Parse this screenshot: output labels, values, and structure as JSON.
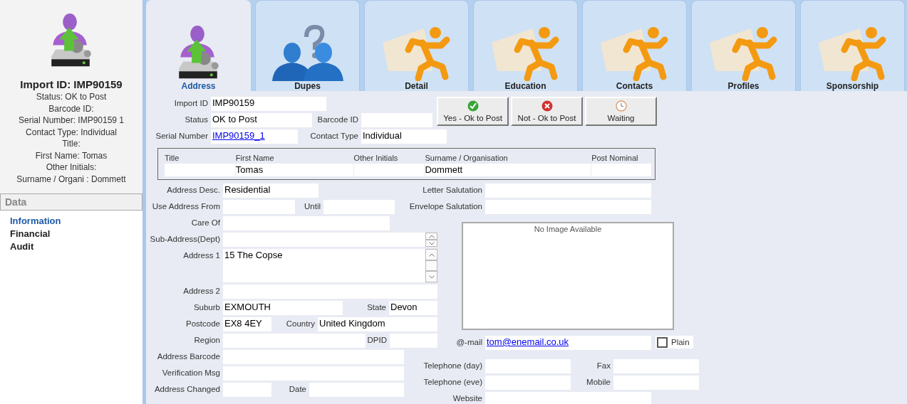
{
  "sidebar": {
    "title": "Import ID: IMP90159",
    "details": [
      "Status: OK to Post",
      "Barcode ID:",
      "Serial Number: IMP90159 1",
      "Contact Type: Individual",
      "Title:",
      "First Name: Tomas",
      "Other Initials:",
      "Surname / Organi : Dommett"
    ],
    "section": "Data",
    "items": [
      {
        "label": "Information",
        "selected": true
      },
      {
        "label": "Financial",
        "selected": false
      },
      {
        "label": "Audit",
        "selected": false
      }
    ]
  },
  "tabs": [
    {
      "label": "Address",
      "selected": true
    },
    {
      "label": "Dupes",
      "selected": false
    },
    {
      "label": "Detail",
      "selected": false
    },
    {
      "label": "Education",
      "selected": false
    },
    {
      "label": "Contacts",
      "selected": false
    },
    {
      "label": "Profiles",
      "selected": false
    },
    {
      "label": "Sponsorship",
      "selected": false
    }
  ],
  "form": {
    "top_rows": [
      {
        "kind": "fields",
        "fields": [
          {
            "label": "Import ID",
            "value": "IMP90159",
            "kind": "text"
          }
        ]
      },
      {
        "kind": "fields",
        "fields": [
          {
            "label": "Status",
            "value": "OK to Post",
            "kind": "text"
          },
          {
            "label": "Barcode ID",
            "kind": "text"
          }
        ]
      },
      {
        "kind": "fields",
        "fields": [
          {
            "label": "Serial Number",
            "value": "IMP90159_1",
            "kind": "link"
          },
          {
            "label": "Contact Type",
            "value": "Individual",
            "kind": "text"
          }
        ]
      }
    ],
    "status_buttons": [
      "Yes - Ok to Post",
      "Not - Ok to Post",
      "Waiting"
    ],
    "name_grid": [
      {
        "heading": "Title"
      },
      {
        "heading": "First Name",
        "value": "Tomas"
      },
      {
        "heading": "Other Initials"
      },
      {
        "heading": "Surname / Organisation",
        "value": "Dommett"
      },
      {
        "heading": "Post Nominal"
      }
    ],
    "address_rows": [
      {
        "kind": "fields",
        "fields": [
          {
            "label": "Address Desc.",
            "value": "Residential",
            "kind": "text"
          }
        ]
      },
      {
        "kind": "fields",
        "fields": [
          {
            "label": "Use Address From",
            "kind": "text"
          },
          {
            "label": "Until",
            "kind": "text"
          }
        ]
      },
      {
        "kind": "fields",
        "fields": [
          {
            "label": "Care Of",
            "kind": "text"
          }
        ]
      },
      {
        "kind": "fields",
        "fields": [
          {
            "label": "Sub-Address(Dept)",
            "kind": "spin"
          }
        ]
      },
      {
        "kind": "fields",
        "fields": [
          {
            "label": "Address 1",
            "value": "15 The Copse",
            "kind": "memo"
          }
        ]
      },
      {
        "kind": "fields",
        "fields": [
          {
            "label": "Address 2",
            "kind": "text"
          }
        ]
      },
      {
        "kind": "fields",
        "fields": [
          {
            "label": "Suburb",
            "value": "EXMOUTH",
            "kind": "text"
          },
          {
            "label": "State",
            "value": "Devon",
            "kind": "text"
          }
        ]
      },
      {
        "kind": "fields",
        "fields": [
          {
            "label": "Postcode",
            "value": "EX8 4EY",
            "kind": "text"
          },
          {
            "label": "Country",
            "value": "United Kingdom",
            "kind": "text"
          }
        ]
      },
      {
        "kind": "fields",
        "fields": [
          {
            "label": "Region",
            "kind": "text"
          },
          {
            "label": "DPID",
            "kind": "text"
          }
        ]
      },
      {
        "kind": "fields",
        "fields": [
          {
            "label": "Address Barcode",
            "kind": "text"
          }
        ]
      },
      {
        "kind": "fields",
        "fields": [
          {
            "label": "Verification Msg",
            "kind": "text"
          }
        ]
      },
      {
        "kind": "fields",
        "fields": [
          {
            "label": "Address Changed",
            "kind": "text"
          },
          {
            "label": "Date",
            "kind": "text"
          }
        ]
      }
    ],
    "contact_rows": [
      {
        "kind": "fields",
        "fields": [
          {
            "label": "Letter Salutation",
            "kind": "text"
          }
        ]
      },
      {
        "kind": "fields",
        "fields": [
          {
            "label": "Envelope Salutation",
            "kind": "text"
          }
        ]
      },
      {
        "kind": "image",
        "text": "No Image Available"
      },
      {
        "kind": "fields",
        "fields": [
          {
            "label": "@-mail",
            "value": "tom@enemail.co.uk",
            "kind": "link"
          }
        ],
        "option": {
          "label": "Plain",
          "checked": false
        }
      },
      {
        "kind": "fields",
        "fields": [
          {
            "label": "Telephone (day)",
            "kind": "text"
          },
          {
            "label": "Fax",
            "kind": "text"
          }
        ]
      },
      {
        "kind": "fields",
        "fields": [
          {
            "label": "Telephone (eve)",
            "kind": "text"
          },
          {
            "label": "Mobile",
            "kind": "text"
          }
        ]
      },
      {
        "kind": "fields",
        "fields": [
          {
            "label": "Website",
            "kind": "text"
          }
        ]
      }
    ]
  }
}
